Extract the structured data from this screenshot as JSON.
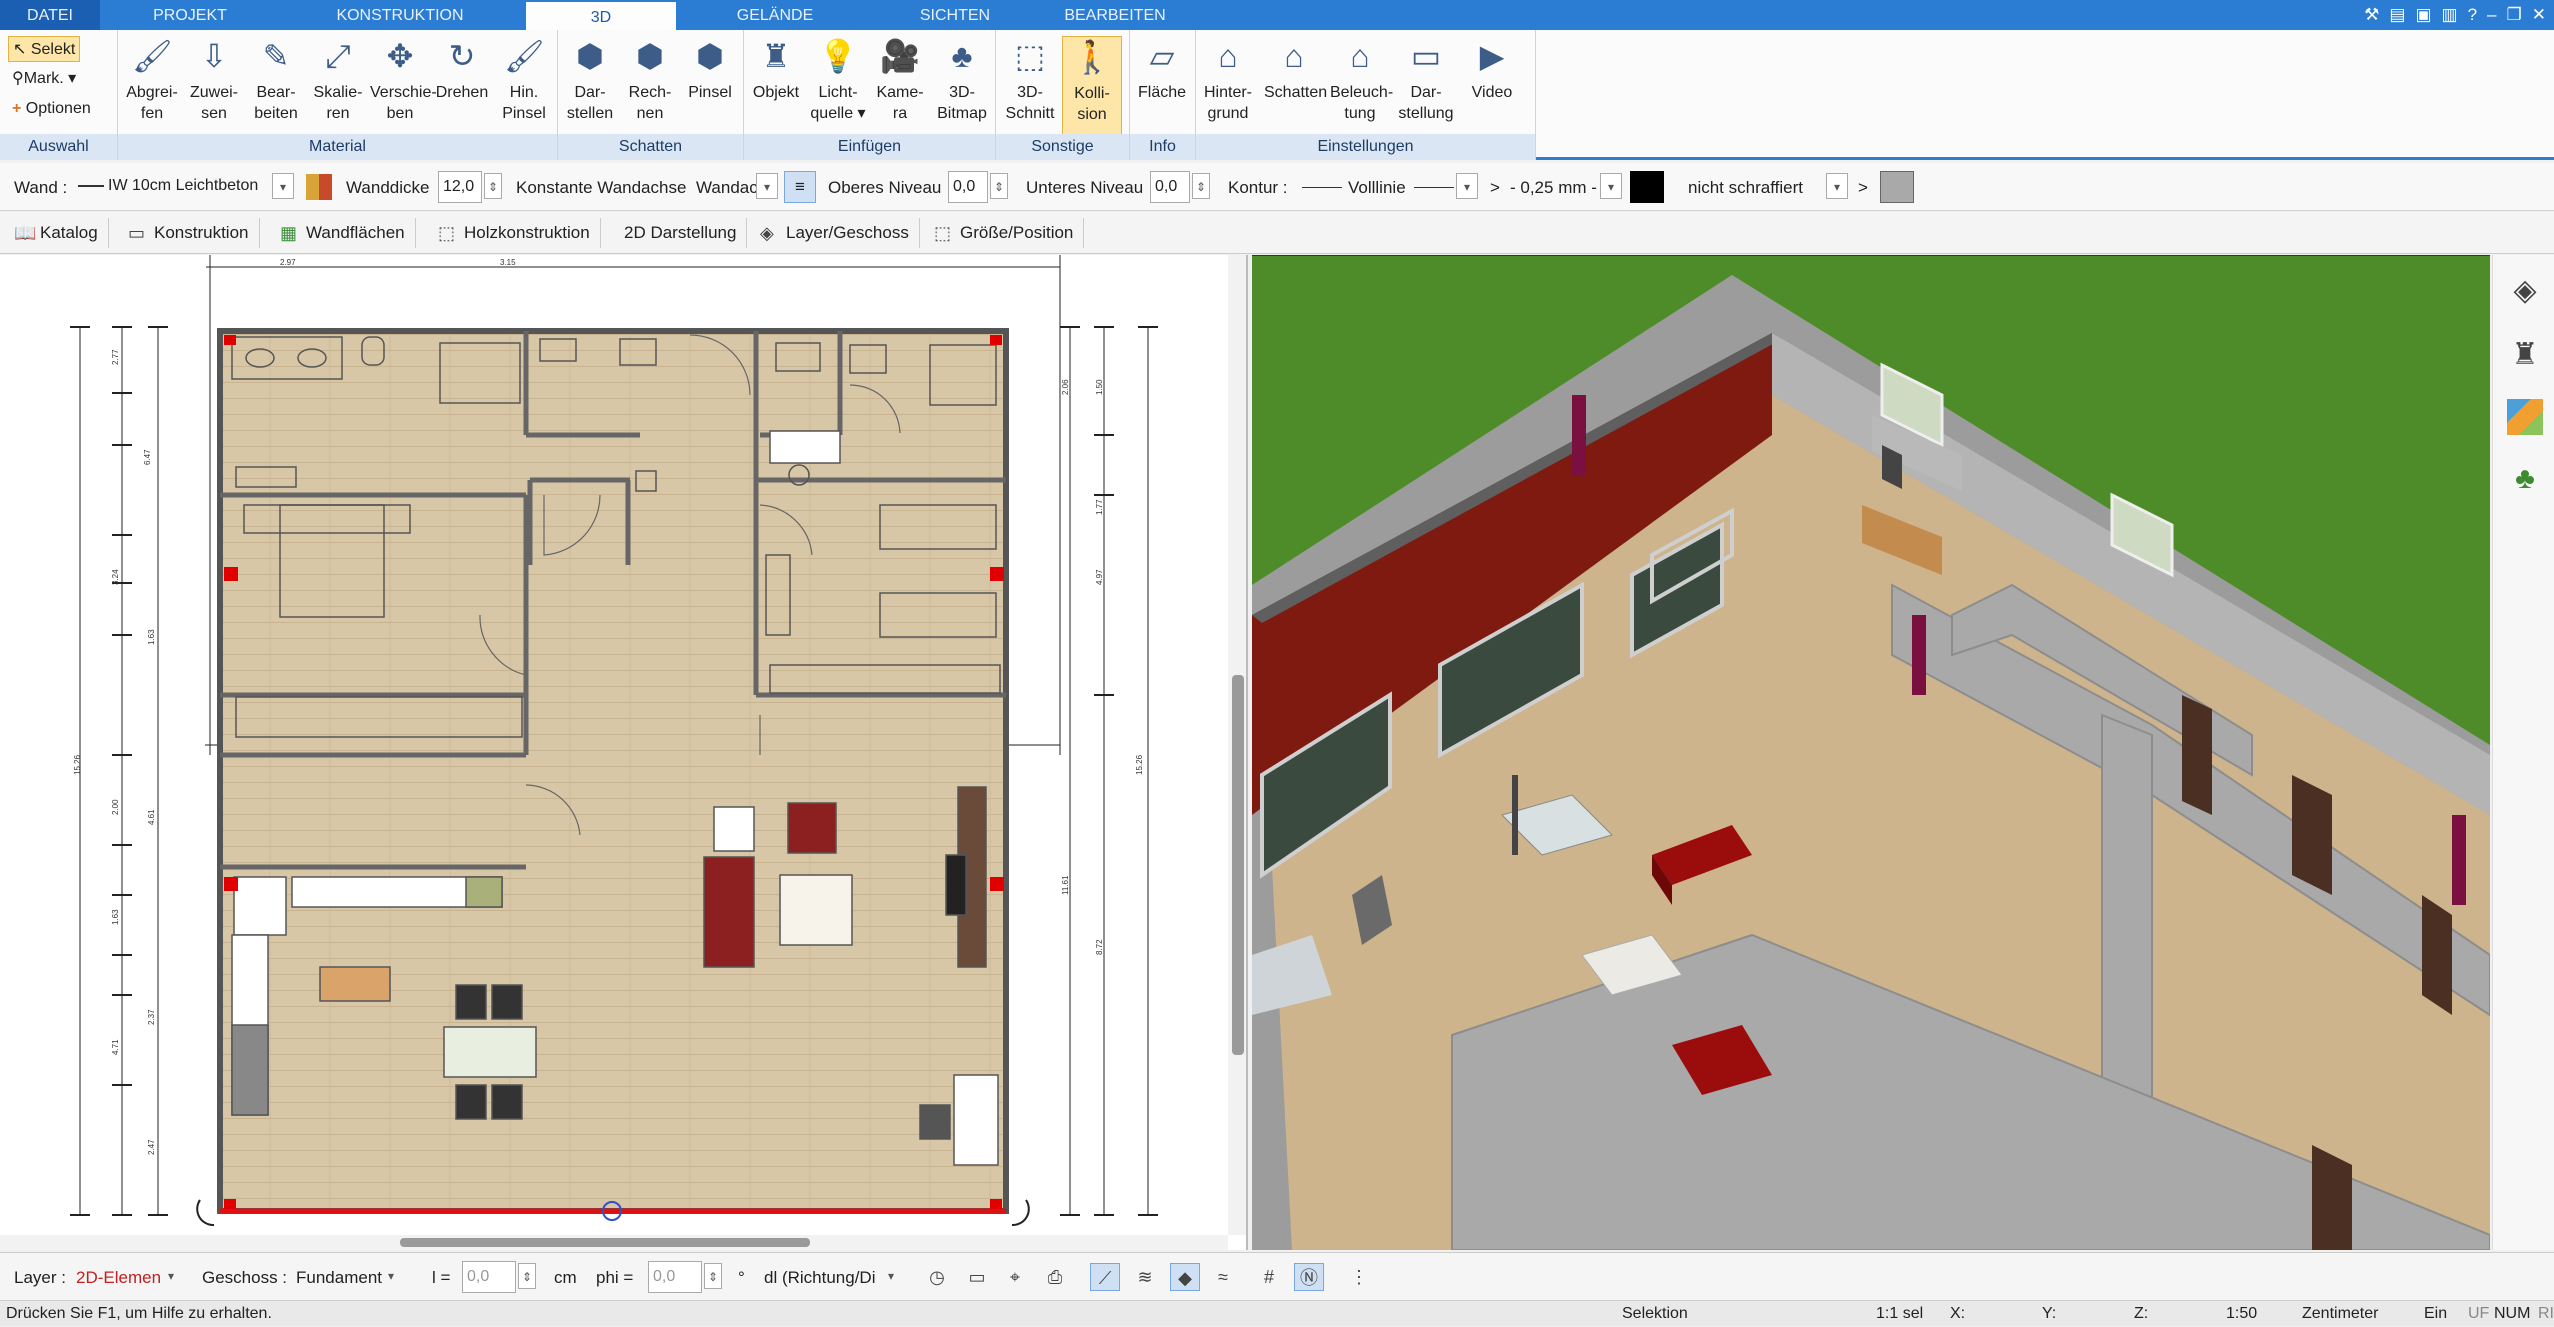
{
  "menu": {
    "tabs": [
      "DATEI",
      "PROJEKT",
      "KONSTRUKTION",
      "3D",
      "GELÄNDE",
      "SICHTEN",
      "BEARBEITEN"
    ],
    "active_tab": "3D"
  },
  "ribbon": {
    "auswahl": {
      "label": "Auswahl",
      "selekt": "Selekt",
      "mark": "Mark.",
      "optionen": "Optionen"
    },
    "material": {
      "label": "Material",
      "buttons": [
        "Abgrei-\nfen",
        "Zuwei-\nsen",
        "Bear-\nbeiten",
        "Skalie-\nren",
        "Verschie-\nben",
        "Drehen",
        "Hin.\nPinsel"
      ]
    },
    "schatten": {
      "label": "Schatten",
      "buttons": [
        "Dar-\nstellen",
        "Rech-\nnen",
        "Pinsel"
      ]
    },
    "einfuegen": {
      "label": "Einfügen",
      "buttons": [
        "Objekt",
        "Licht-\nquelle ▾",
        "Kame-\nra",
        "3D-\nBitmap"
      ]
    },
    "sonstige": {
      "label": "Sonstige",
      "buttons": [
        "3D-\nSchnitt",
        "Kolli-\nsion"
      ]
    },
    "info": {
      "label": "Info",
      "buttons": [
        "Fläche"
      ]
    },
    "einstellungen": {
      "label": "Einstellungen",
      "buttons": [
        "Hinter-\ngrund",
        "Schatten",
        "Beleuch-\ntung",
        "Dar-\nstellung",
        "Video"
      ]
    }
  },
  "props": {
    "wand_label": "Wand :",
    "wand_value": "IW 10cm Leichtbeton",
    "wanddicke_label": "Wanddicke",
    "wanddicke_value": "12,0",
    "wandachse_label": "Konstante Wandachse",
    "wandachse_value": "Wandac",
    "oberes_label": "Oberes Niveau",
    "oberes_value": "0,0",
    "unteres_label": "Unteres Niveau",
    "unteres_value": "0,0",
    "kontur_label": "Kontur :",
    "linie_value": "Volllinie",
    "mm_value": "- 0,25 mm -",
    "gt1": ">",
    "gt2": ">",
    "schraffur_value": "nicht schraffiert",
    "contour_color": "#000000",
    "fill_color": "#a9a9a9"
  },
  "tabs2": [
    "Katalog",
    "Konstruktion",
    "Wandflächen",
    "Holzkonstruktion",
    "2D Darstellung",
    "Layer/Geschoss",
    "Größe/Position"
  ],
  "plan_dims": {
    "top_small": [
      "2.97",
      "3.15"
    ],
    "left": [
      "2.77",
      "6.47",
      "3.24",
      "1.63",
      "2.00",
      "4.61",
      "1.63",
      "2.37",
      "4.71",
      "2.47",
      "15.26"
    ],
    "right": [
      "2.06",
      "1.50",
      "1.77",
      "4.97",
      "11.61",
      "8.72",
      "15.26"
    ]
  },
  "bottom": {
    "layer_label": "Layer :",
    "layer_value": "2D-Elemen",
    "geschoss_label": "Geschoss :",
    "geschoss_value": "Fundament",
    "l_label": "l =",
    "l_value": "0,0",
    "cm_label": "cm",
    "phi_label": "phi =",
    "phi_value": "0,0",
    "deg_label": "°",
    "dl_value": "dl (Richtung/Di"
  },
  "status": {
    "help": "Drücken Sie F1, um Hilfe zu erhalten.",
    "mode": "Selektion",
    "sel": "1:1 sel",
    "x": "X:",
    "y": "Y:",
    "z": "Z:",
    "scale": "1:50",
    "unit": "Zentimeter",
    "ein": "Ein",
    "uf": "UF",
    "num": "NUM",
    "ri": "RI"
  },
  "colors": {
    "accent": "#2b7cd3",
    "floor": "#d7c6a6",
    "grass": "#4f8d2a",
    "wall_red": "#8a1f14"
  }
}
